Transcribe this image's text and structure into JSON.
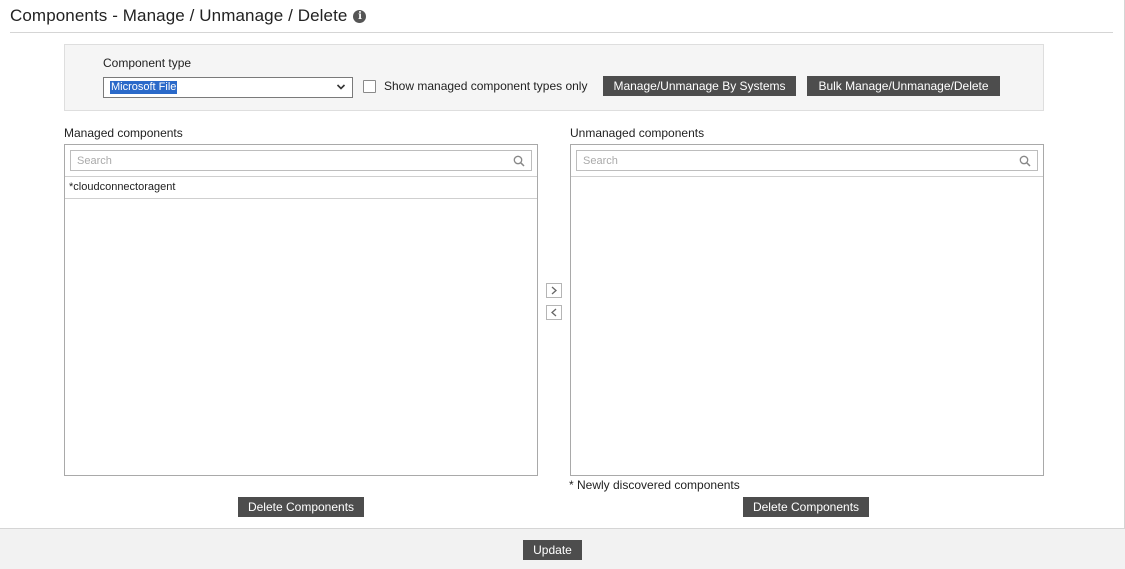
{
  "header": {
    "title": "Components - Manage / Unmanage / Delete",
    "info_icon": "info-icon"
  },
  "filter": {
    "component_type_label": "Component type",
    "component_type_value": "Microsoft File",
    "show_managed_label": "Show managed component types only",
    "show_managed_checked": false,
    "manage_by_systems_label": "Manage/Unmanage By Systems",
    "bulk_label": "Bulk Manage/Unmanage/Delete"
  },
  "managed": {
    "label": "Managed components",
    "search_placeholder": "Search",
    "items": [
      "*cloudconnectoragent"
    ],
    "delete_label": "Delete Components"
  },
  "unmanaged": {
    "label": "Unmanaged components",
    "search_placeholder": "Search",
    "items": [],
    "note": "* Newly discovered components",
    "delete_label": "Delete Components"
  },
  "footer": {
    "update_label": "Update"
  },
  "colors": {
    "button_bg": "#4d4d4d",
    "selection_highlight": "#2a69c9",
    "panel_bg": "#f5f5f5"
  }
}
